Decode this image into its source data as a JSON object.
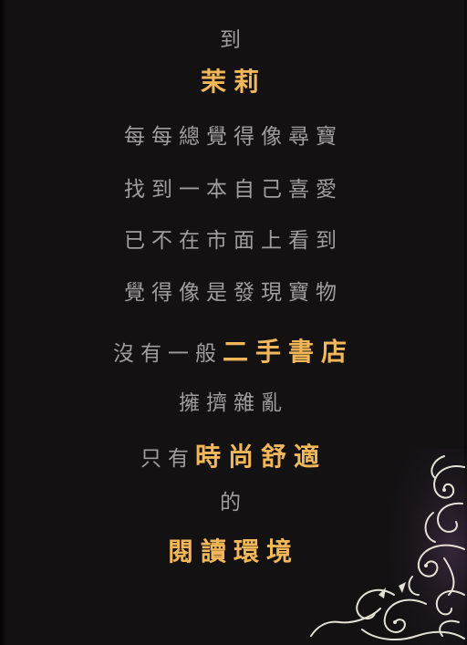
{
  "lines": {
    "l1": "到",
    "l2": "茉莉",
    "l3": "每每總覺得像尋寶",
    "l4": "找到一本自己喜愛",
    "l5": "已不在市面上看到",
    "l6": "覺得像是發現寶物",
    "l7a": "沒有一般",
    "l7b": "二手書店",
    "l8": "擁擠雜亂",
    "l9a": "只有",
    "l9b": "時尚舒適",
    "l10": "的",
    "l11": "閱讀環境"
  },
  "colors": {
    "background": "#141113",
    "text_gray": "#9e9e9e",
    "text_gold": "#f2b758"
  },
  "decoration": {
    "icon": "floral-swirl-ornament"
  }
}
